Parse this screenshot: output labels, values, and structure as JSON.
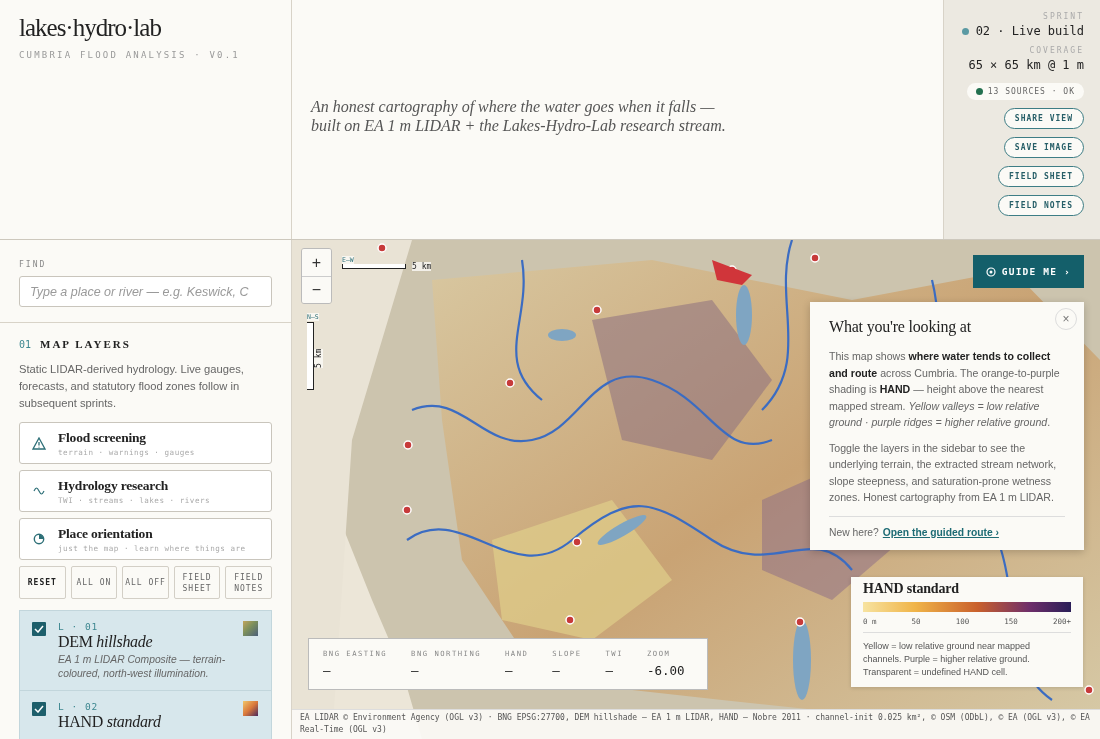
{
  "brand": {
    "title": "lakes·hydro·lab",
    "subtitle": "CUMBRIA FLOOD ANALYSIS · V0.1"
  },
  "tagline": "An honest cartography of where the water goes when it falls — built on EA 1 m LIDAR + the Lakes-Hydro-Lab research stream.",
  "status": {
    "sprint_label": "SPRINT",
    "sprint": "02 · Live build",
    "coverage_label": "COVERAGE",
    "coverage": "65 × 65 km @ 1 m",
    "sources": "13 SOURCES · OK",
    "actions": [
      "SHARE VIEW",
      "SAVE IMAGE",
      "FIELD SHEET",
      "FIELD NOTES"
    ]
  },
  "find": {
    "label": "FIND",
    "placeholder": "Type a place or river — e.g. Keswick, C"
  },
  "section": {
    "number": "01",
    "title": "MAP LAYERS",
    "description": "Static LIDAR-derived hydrology. Live gauges, forecasts, and statutory flood zones follow in subsequent sprints."
  },
  "presets": [
    {
      "kind": "warning",
      "title": "Flood screening",
      "subtitle": "terrain · warnings · gauges"
    },
    {
      "kind": "wave",
      "title": "Hydrology research",
      "subtitle": "TWI · streams · lakes · rivers"
    },
    {
      "kind": "pie",
      "title": "Place orientation",
      "subtitle": "just the map · learn where things are"
    }
  ],
  "tools": [
    {
      "label": "RESET",
      "kind": "primary"
    },
    {
      "label": "ALL ON",
      "kind": "plain"
    },
    {
      "label": "ALL OFF",
      "kind": "plain"
    },
    {
      "label": "FIELD SHEET",
      "kind": "plain"
    },
    {
      "label": "FIELD NOTES",
      "kind": "plain"
    }
  ],
  "layers": [
    {
      "code": "L · 01",
      "title": "DEM *hillshade*",
      "description": "EA 1 m LIDAR Composite — terrain-coloured, north-west illumination.",
      "checked": true,
      "kind": "hillshade"
    },
    {
      "code": "L · 02",
      "title": "HAND *standard*",
      "checked": true,
      "kind": "hand"
    }
  ],
  "map": {
    "zoom_controls": [
      "+",
      "−"
    ],
    "axis_x": "E–W",
    "scale_x": "5 km",
    "axis_y": "N–S",
    "scale_y": "5 km",
    "guide_button": "GUIDE ME ›",
    "info": {
      "title": "What you're looking at",
      "close": "×",
      "paragraphs": [
        "This map shows **where water tends to collect and route** across Cumbria. The orange-to-purple shading is **HAND** — height above the nearest mapped stream. *Yellow valleys = low relative ground · purple ridges = higher relative ground*.",
        "Toggle the layers in the sidebar to see the underlying terrain, the extracted stream network, slope steepness, and saturation-prone wetness zones. Honest cartography from EA 1 m LIDAR."
      ],
      "footer_text": "New here?",
      "footer_link": "Open the guided route ›"
    },
    "legend": {
      "title": "HAND standard",
      "ticks": [
        "0 m",
        "50",
        "100",
        "150",
        "200+"
      ],
      "note": "Yellow = low relative ground near mapped channels. Purple = higher relative ground. Transparent = undefined HAND cell."
    },
    "readout": [
      {
        "label": "BNG EASTING",
        "value": "–"
      },
      {
        "label": "BNG NORTHING",
        "value": "–"
      },
      {
        "label": "HAND",
        "value": "–"
      },
      {
        "label": "SLOPE",
        "value": "–"
      },
      {
        "label": "TWI",
        "value": "–"
      },
      {
        "label": "ZOOM",
        "value": "-6.00"
      }
    ],
    "attribution": "EA LIDAR © Environment Agency (OGL v3) · BNG EPSG:27700, DEM hillshade — EA 1 m LIDAR, HAND — Nobre 2011 · channel-init 0.025 km², © OSM (ODbL), © EA (OGL v3), © EA Real-Time (OGL v3)"
  }
}
